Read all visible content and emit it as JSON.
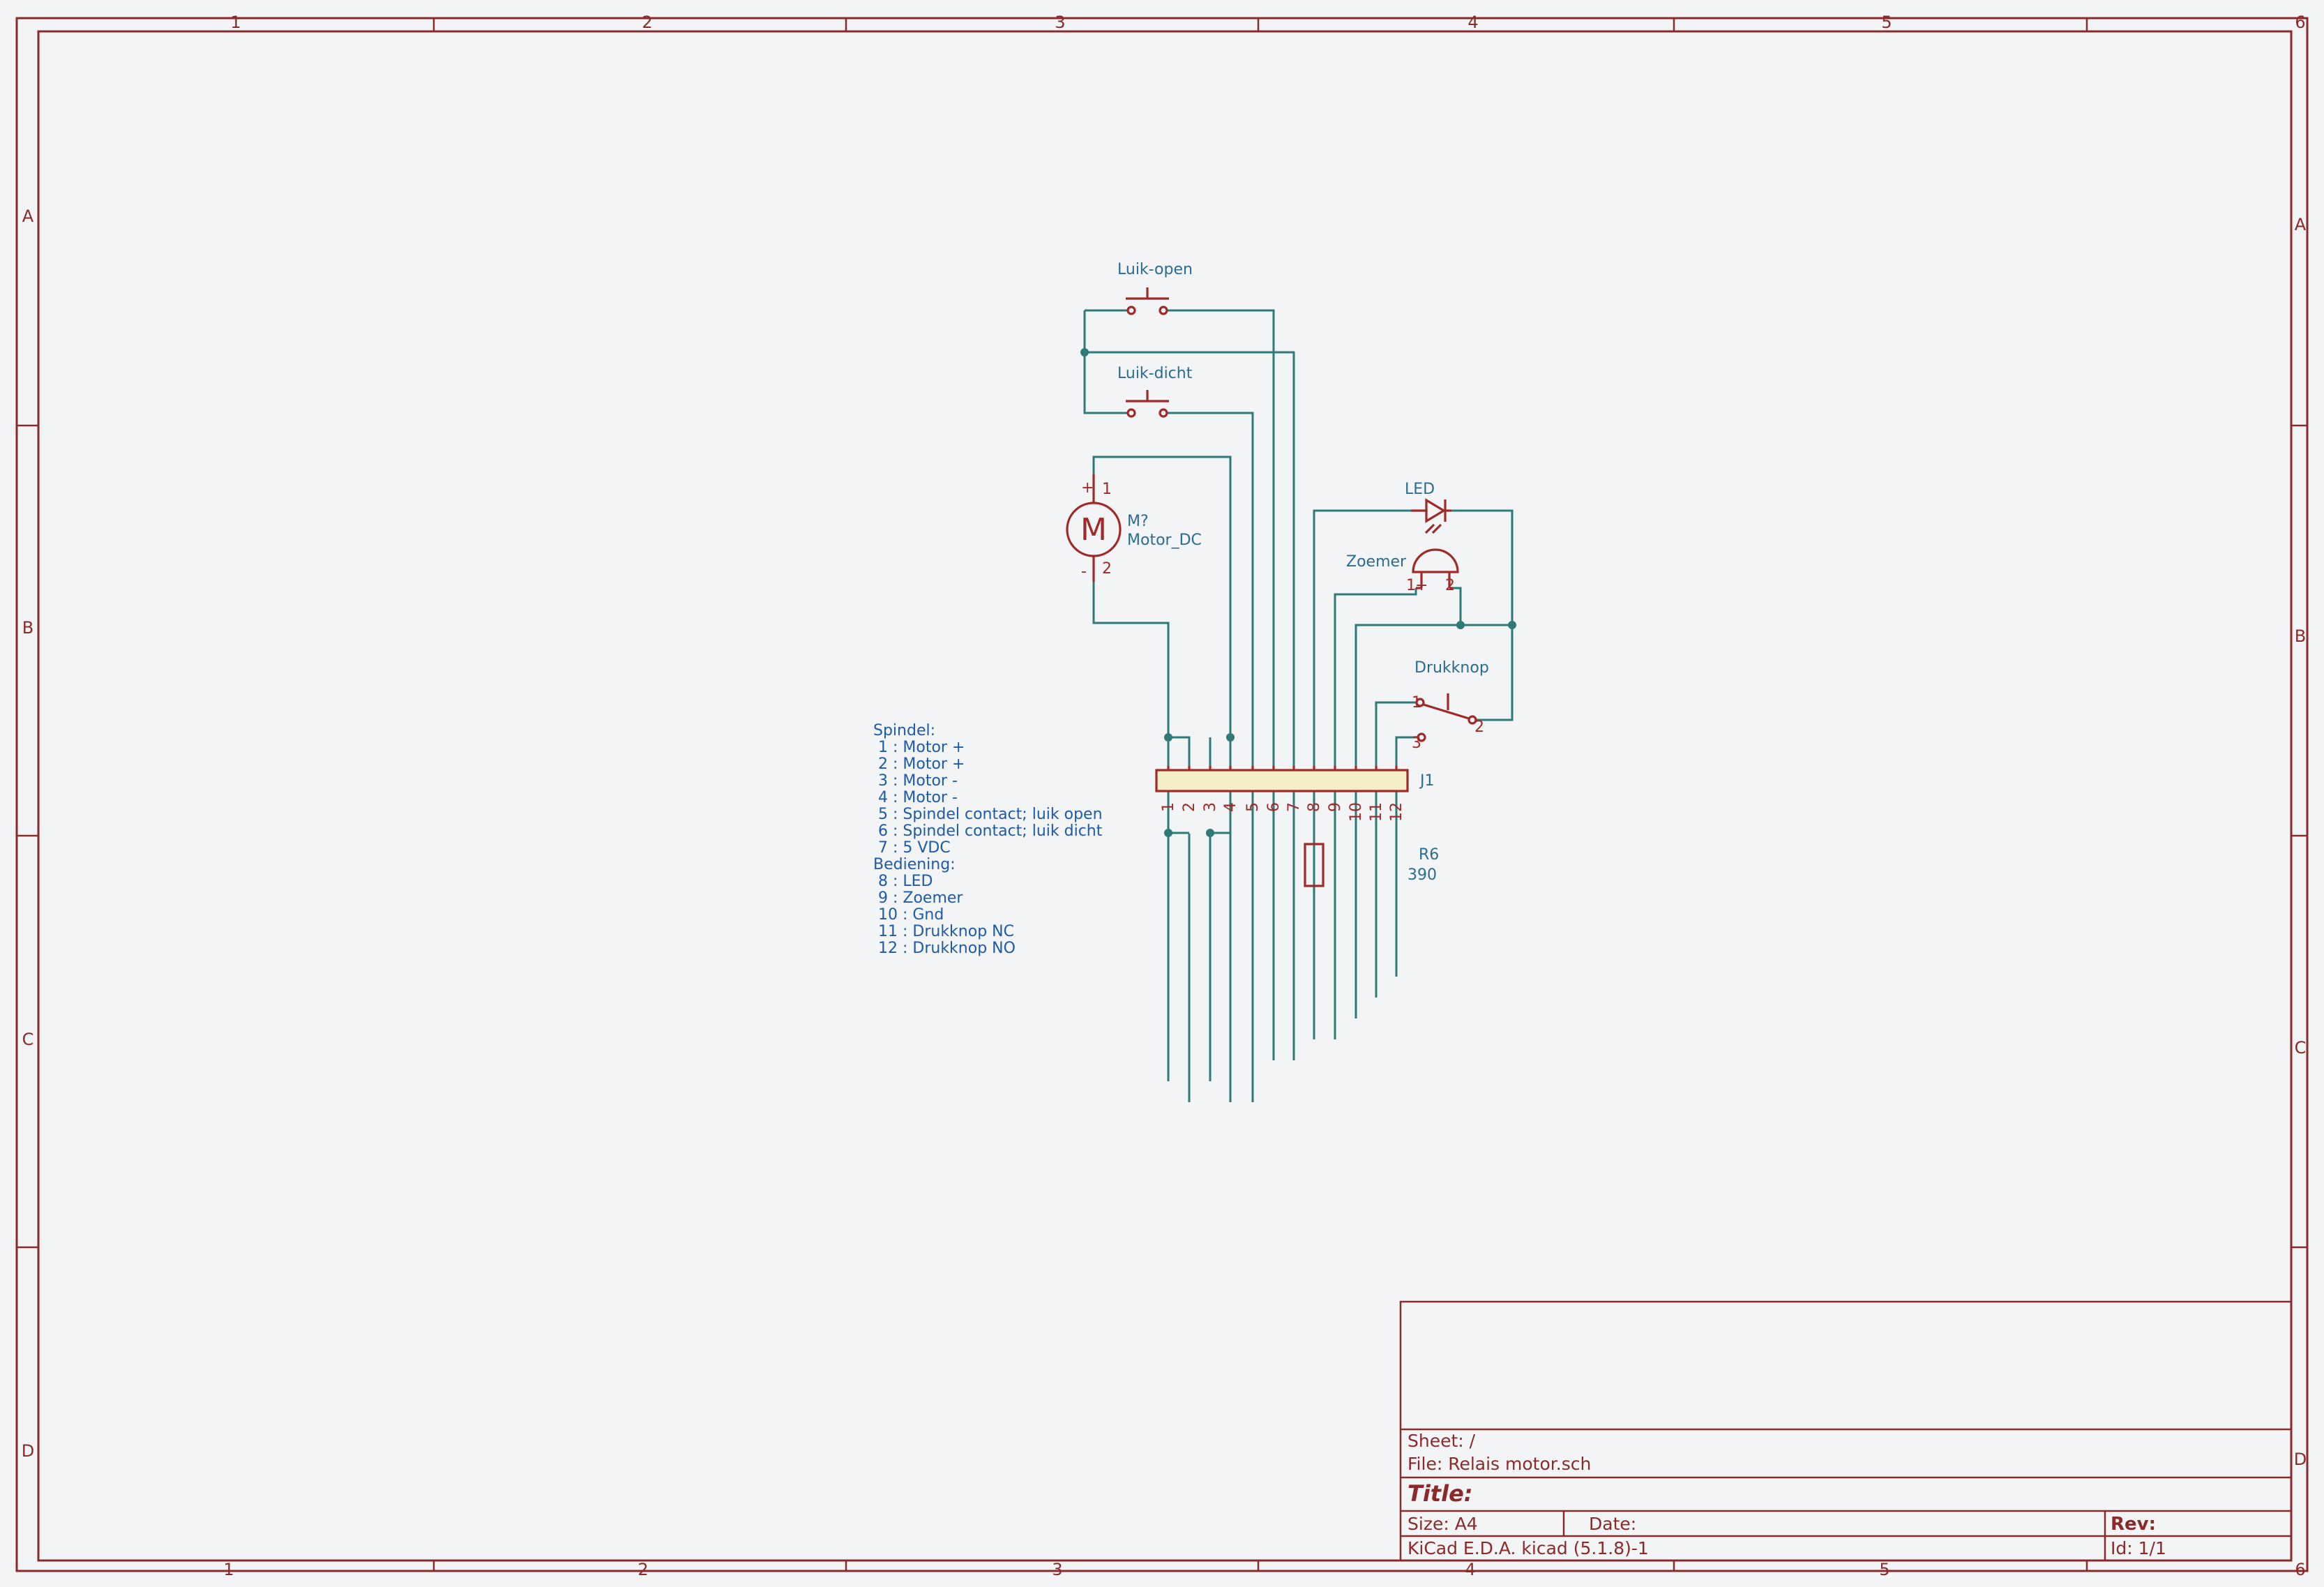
{
  "border": {
    "columns": [
      "1",
      "2",
      "3",
      "4",
      "5",
      "6"
    ],
    "rows": [
      "A",
      "B",
      "C",
      "D"
    ]
  },
  "components": {
    "sw_open": {
      "ref": "Luik-open"
    },
    "sw_close": {
      "ref": "Luik-dicht"
    },
    "motor": {
      "ref": "M?",
      "value": "Motor_DC",
      "pin_plus": "+",
      "pin_minus": "-",
      "pin1": "1",
      "pin2": "2",
      "glyph": "M"
    },
    "led": {
      "ref": "LED"
    },
    "buzzer": {
      "ref": "Zoemer",
      "pin1": "1",
      "pin2": "2",
      "plus": "+"
    },
    "button": {
      "ref": "Drukknop",
      "pin1": "1",
      "pin2": "2",
      "pin3": "3"
    },
    "connector": {
      "ref": "J1",
      "pins": [
        "1",
        "2",
        "3",
        "4",
        "5",
        "6",
        "7",
        "8",
        "9",
        "10",
        "11",
        "12"
      ]
    },
    "resistor": {
      "ref": "R6",
      "value": "390"
    }
  },
  "notes": {
    "lines": [
      "Spindel:",
      " 1 : Motor +",
      " 2 : Motor +",
      " 3 : Motor -",
      " 4 : Motor -",
      " 5 : Spindel contact; luik open",
      " 6 : Spindel contact; luik dicht",
      " 7 : 5 VDC",
      "Bediening:",
      " 8 : LED",
      " 9 : Zoemer",
      " 10 : Gnd",
      " 11 : Drukknop NC",
      " 12 : Drukknop NO"
    ]
  },
  "title_block": {
    "sheet": "Sheet: /",
    "file": "File: Relais motor.sch",
    "title": "Title:",
    "size": "Size: A4",
    "date": "Date:",
    "kicad": "KiCad E.D.A.  kicad (5.1.8)-1",
    "rev": "Rev:",
    "id": "Id: 1/1"
  },
  "colors": {
    "frame": "#8a2a2a",
    "wire": "#2d7a78",
    "symbol": "#a02a2a",
    "connector_fill": "#f5efc8",
    "reference_text": "#2a6c90",
    "notes_text": "#1d5aa8"
  }
}
